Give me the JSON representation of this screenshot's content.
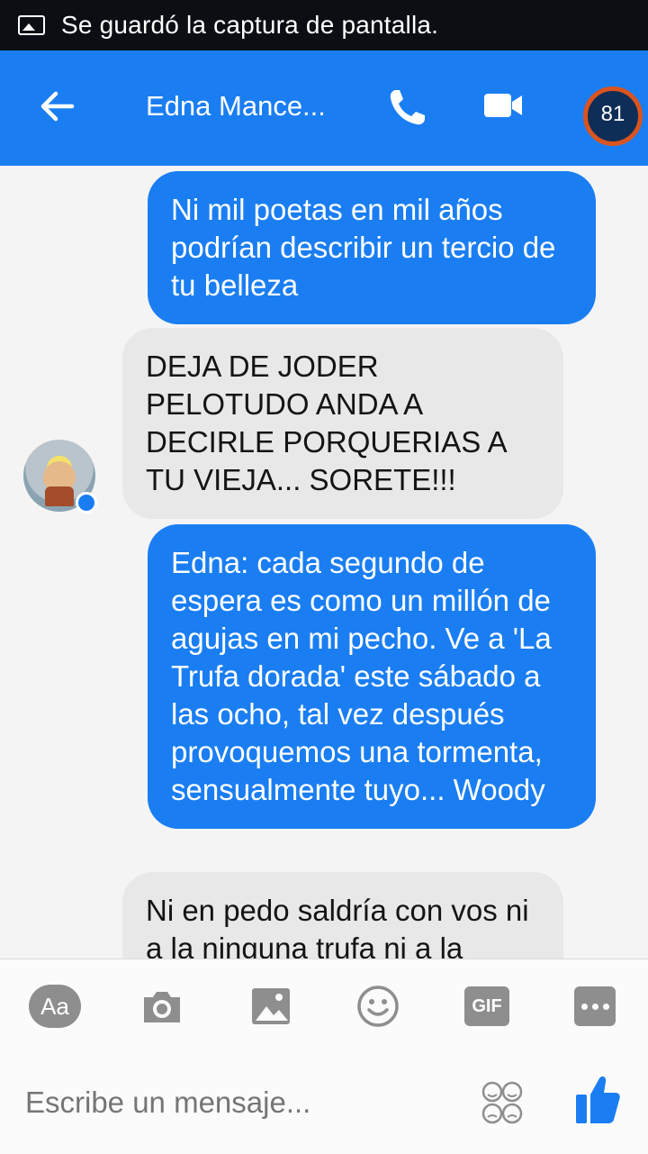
{
  "status_bar": {
    "notification": "Se guardó la captura de pantalla."
  },
  "header": {
    "contact_name": "Edna Mance...",
    "info_badge": "81"
  },
  "messages": [
    {
      "from": "me",
      "text": "Ni mil poetas en mil años podrían describir un tercio de tu belleza"
    },
    {
      "from": "them",
      "text": "DEJA DE JODER PELOTUDO ANDA A DECIRLE PORQUERIAS A TU VIEJA... SORETE!!!"
    },
    {
      "from": "me",
      "text": "Edna: cada segundo de espera es como un millón de agujas en mi pecho. Ve a 'La Trufa dorada' este sábado a las ocho, tal vez después provoquemos una tormenta, sensualmente tuyo... Woody"
    },
    {
      "from": "them",
      "text": "Ni en pedo saldría con vos ni a la ninguna trufa ni a la"
    }
  ],
  "composer": {
    "aa_label": "Aa",
    "gif_label": "GIF",
    "placeholder": "Escribe un mensaje..."
  },
  "icons": [
    "screenshot-icon",
    "back-arrow-icon",
    "phone-icon",
    "video-icon",
    "info-icon",
    "camera-icon",
    "gallery-icon",
    "smiley-icon",
    "more-icon",
    "emoji-picker-icon",
    "thumbs-up-icon"
  ],
  "colors": {
    "accent": "#1a7ef2",
    "incoming_bubble": "#e8e8e8",
    "status_bar": "#0b0f14"
  }
}
